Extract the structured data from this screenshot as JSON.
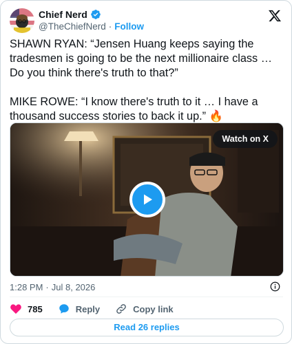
{
  "author": {
    "display_name": "Chief Nerd",
    "handle": "@TheChiefNerd",
    "follow_label": "Follow",
    "verified_color": "#1d9bf0"
  },
  "tweet": {
    "text": "SHAWN RYAN: “Jensen Huang keeps saying the tradesmen is going to be the next millionaire class … Do you think there's truth to that?”\n\nMIKE ROWE: “I know there's truth to it … I have a thousand success stories to back it up.” 🔥"
  },
  "media": {
    "watch_label": "Watch on X",
    "play_icon": "play-icon"
  },
  "meta": {
    "time": "1:28 PM",
    "date": "Jul 8, 2026"
  },
  "actions": {
    "likes": "785",
    "reply_label": "Reply",
    "copy_link_label": "Copy link"
  },
  "read_replies_label": "Read 26 replies",
  "colors": {
    "accent": "#1d9bf0",
    "like": "#f91880",
    "text": "#0f1419",
    "secondary": "#536471"
  }
}
